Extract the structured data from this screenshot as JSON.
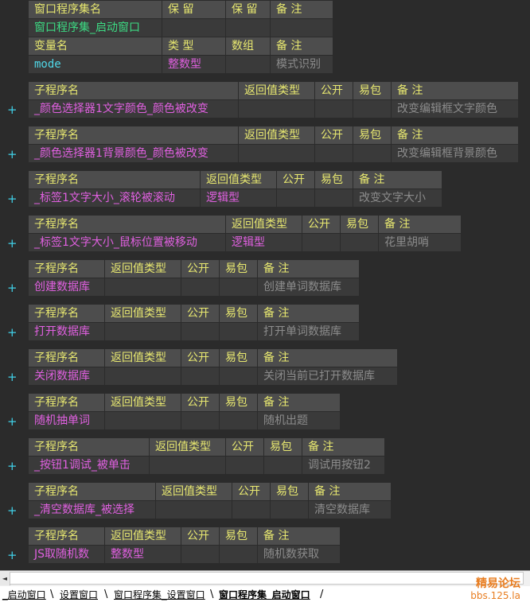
{
  "header": {
    "set_cols": [
      "窗口程序集名",
      "保 留",
      "保 留",
      "备 注"
    ],
    "set_row": [
      "窗口程序集_启动窗口",
      "",
      "",
      ""
    ],
    "var_cols": [
      "变量名",
      "类 型",
      "数组",
      "备 注"
    ],
    "var_row": [
      "mode",
      "整数型",
      "",
      "模式识别"
    ]
  },
  "sub_cols": [
    "子程序名",
    "返回值类型",
    "公开",
    "易包",
    "备 注"
  ],
  "subs": [
    {
      "name": "_颜色选择器1文字颜色_颜色被改变",
      "ret": "",
      "pub": "",
      "pkg": "",
      "note": "改变编辑框文字颜色"
    },
    {
      "name": "_颜色选择器1背景颜色_颜色被改变",
      "ret": "",
      "pub": "",
      "pkg": "",
      "note": "改变编辑框背景颜色"
    },
    {
      "name": "_标签1文字大小_滚轮被滚动",
      "ret": "逻辑型",
      "pub": "",
      "pkg": "",
      "note": "改变文字大小"
    },
    {
      "name": "_标签1文字大小_鼠标位置被移动",
      "ret": "逻辑型",
      "pub": "",
      "pkg": "",
      "note": "花里胡哨"
    },
    {
      "name": "创建数据库",
      "ret": "",
      "pub": "",
      "pkg": "",
      "note": "创建单词数据库"
    },
    {
      "name": "打开数据库",
      "ret": "",
      "pub": "",
      "pkg": "",
      "note": "打开单词数据库"
    },
    {
      "name": "关闭数据库",
      "ret": "",
      "pub": "",
      "pkg": "",
      "note": "关闭当前已打开数据库"
    },
    {
      "name": "随机抽单词",
      "ret": "",
      "pub": "",
      "pkg": "",
      "note": "随机出题"
    },
    {
      "name": "_按钮1调试_被单击",
      "ret": "",
      "pub": "",
      "pkg": "",
      "note": "调试用按钮2"
    },
    {
      "name": "_清空数据库_被选择",
      "ret": "",
      "pub": "",
      "pkg": "",
      "note": "清空数据库"
    },
    {
      "name": "JS取随机数",
      "ret": "整数型",
      "pub": "",
      "pkg": "",
      "note": "随机数获取"
    }
  ],
  "expand_glyph": "+",
  "tabs": [
    "_启动窗口",
    "设置窗口",
    "窗口程序集_设置窗口",
    "窗口程序集_启动窗口"
  ],
  "watermark": {
    "title": "精易论坛",
    "url": "bbs.125.la"
  },
  "scroll_left_glyph": "◄"
}
